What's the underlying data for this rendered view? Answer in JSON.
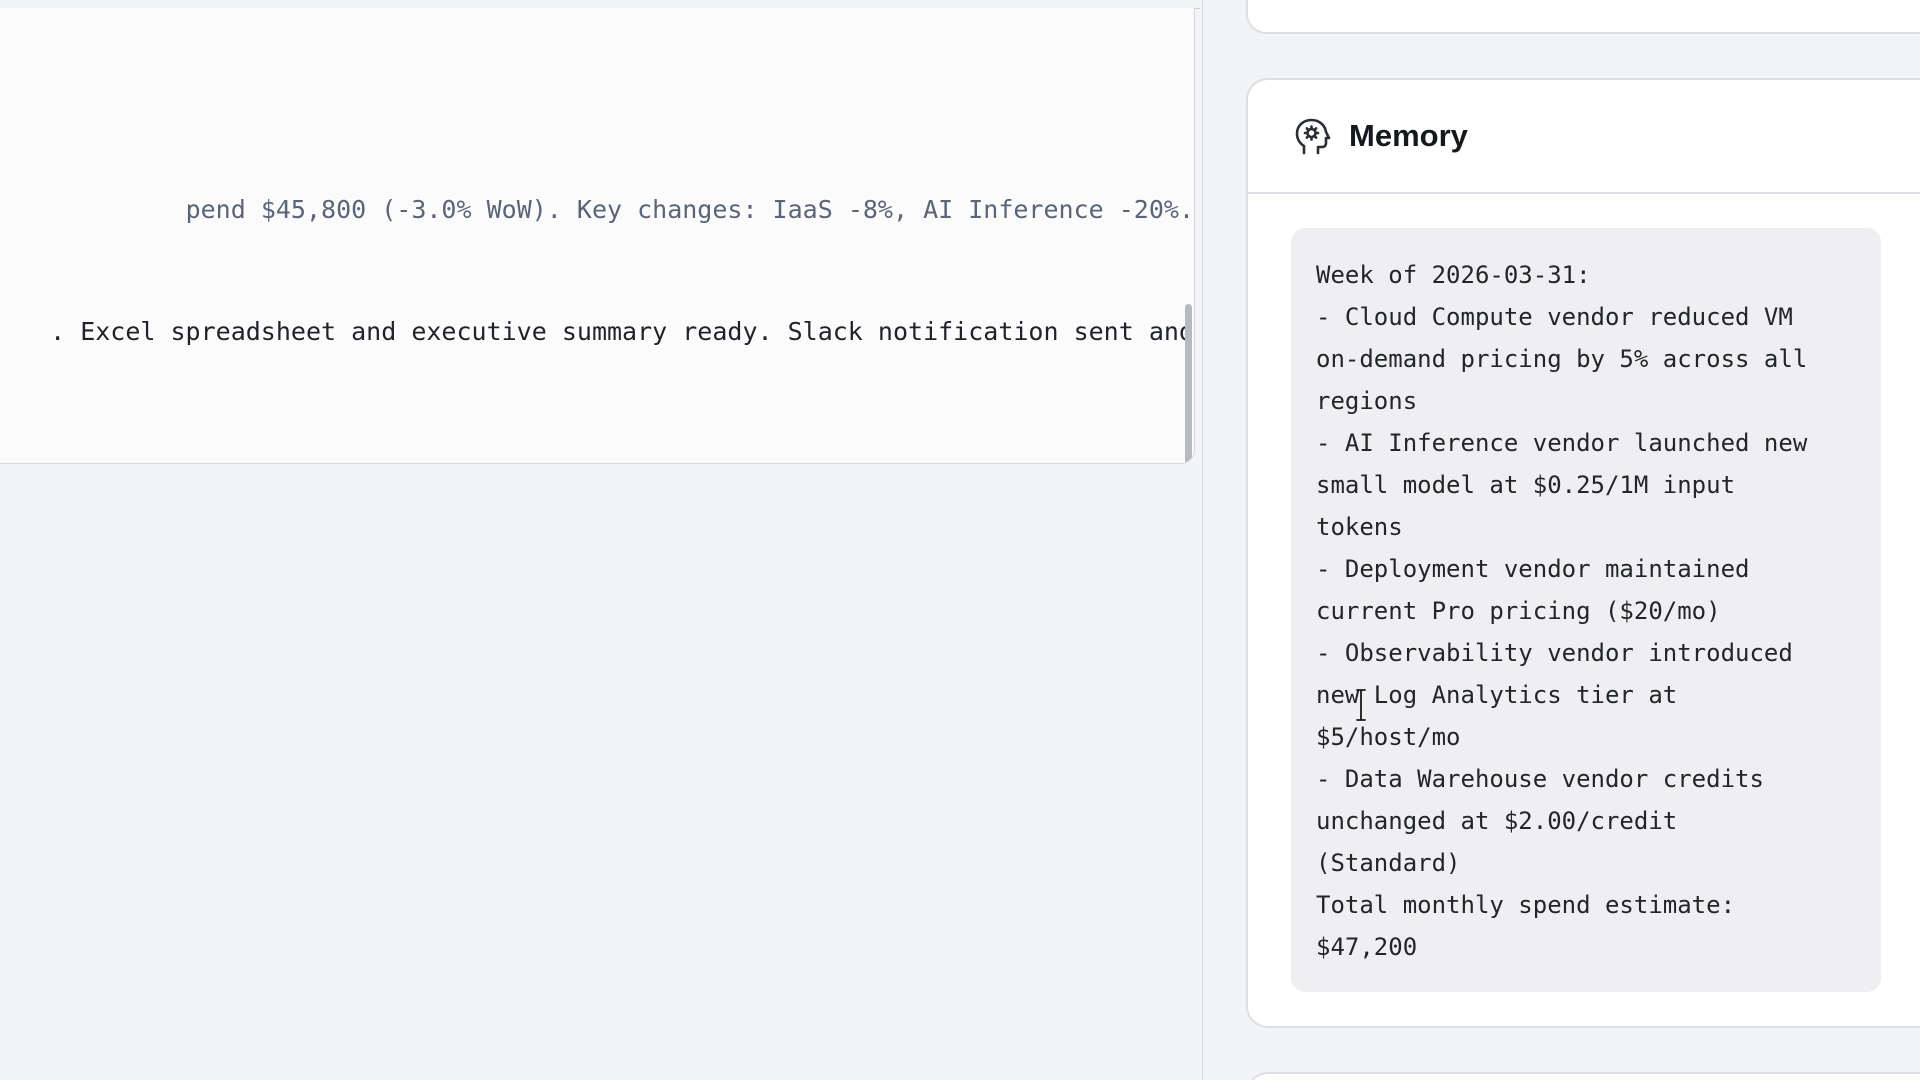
{
  "log": {
    "line_1": "pend $45,800 (-3.0% WoW). Key changes: IaaS -8%, AI Inference -20%.",
    "line_2": ". Excel spreadsheet and executive summary ready. Slack notification sent and"
  },
  "memory": {
    "title": "Memory",
    "icon": "brain-gear-icon",
    "content": "Week of 2026-03-31:\n- Cloud Compute vendor reduced VM\non-demand pricing by 5% across all\nregions\n- AI Inference vendor launched new\nsmall model at $0.25/1M input\ntokens\n- Deployment vendor maintained\ncurrent Pro pricing ($20/mo)\n- Observability vendor introduced\nnew Log Analytics tier at\n$5/host/mo\n- Data Warehouse vendor credits\nunchanged at $2.00/credit\n(Standard)\nTotal monthly spend estimate:\n$47,200"
  },
  "colors": {
    "page_bg": "#f3f4f6",
    "card_bg": "#ffffff",
    "memory_body_bg": "#efeff1",
    "muted_text": "#5a6577",
    "dark_text": "#1f2329"
  }
}
